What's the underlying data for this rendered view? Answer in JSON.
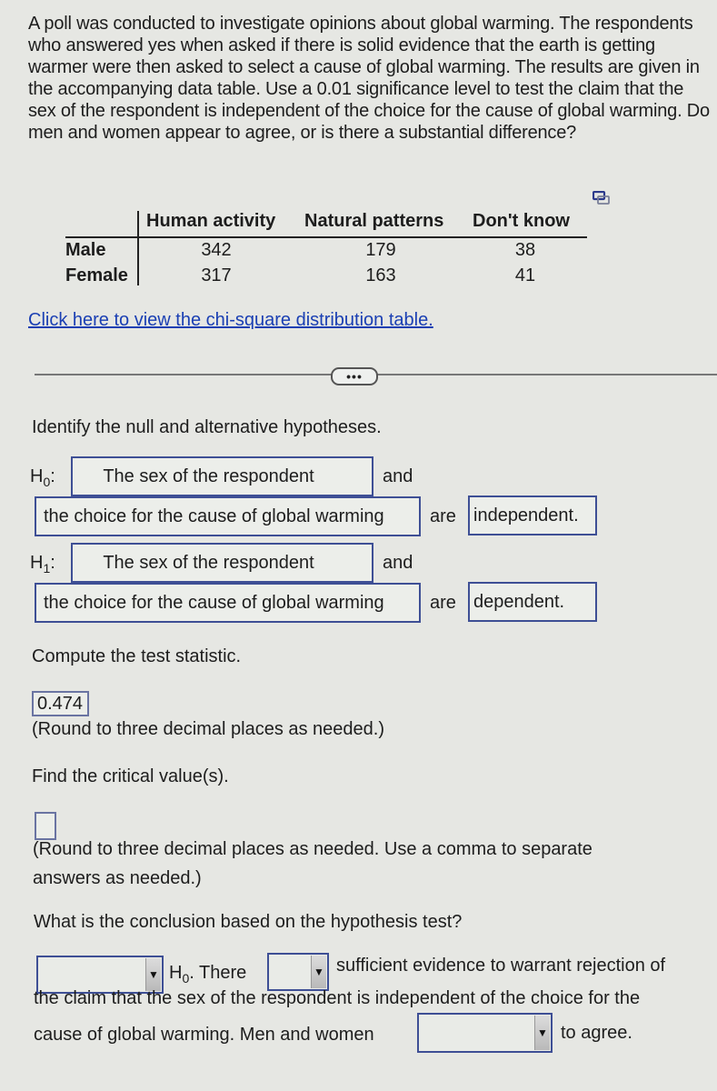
{
  "problem": {
    "intro": "A poll was conducted to investigate opinions about global warming. The respondents who answered yes when asked if there is solid evidence that the earth is getting warmer were then asked to select a cause of global warming. The results are given in the accompanying data table. Use a 0.01 significance level to test the claim that the sex of the respondent is independent of the choice for the cause of global warming. Do men and women appear to agree, or is there a substantial difference?"
  },
  "table": {
    "columns": [
      "Human activity",
      "Natural patterns",
      "Don't know"
    ],
    "rows": [
      {
        "label": "Male",
        "values": [
          "342",
          "179",
          "38"
        ]
      },
      {
        "label": "Female",
        "values": [
          "317",
          "163",
          "41"
        ]
      }
    ],
    "copy_icon": "copy-icon"
  },
  "link_text": "Click here to view the chi-square distribution table.",
  "more_button": "•••",
  "hypotheses": {
    "prompt": "Identify the null and alternative hypotheses.",
    "h0": {
      "label": "H",
      "sub": "0",
      "colon": ":",
      "first": "The sex of the respondent",
      "and": "and",
      "second": "the choice for the cause of global warming",
      "are": "are",
      "relation": "independent."
    },
    "h1": {
      "label": "H",
      "sub": "1",
      "colon": ":",
      "first": "The sex of the respondent",
      "and": "and",
      "second": "the choice for the cause of global warming",
      "are": "are",
      "relation": "dependent."
    }
  },
  "test_statistic": {
    "prompt": "Compute the test statistic.",
    "value": "0.474",
    "note": "(Round to three decimal places as needed.)"
  },
  "critical": {
    "prompt": "Find the critical value(s).",
    "value": "",
    "note_line1": "(Round to three decimal places as needed. Use a comma to separate",
    "note_line2": "answers as needed.)"
  },
  "conclusion": {
    "prompt": "What is the conclusion based on the hypothesis test?",
    "dropdown1_value": "",
    "h0_label": "H",
    "h0_sub": "0",
    "there": ". There",
    "dropdown2_value": "",
    "text1": "sufficient evidence to warrant rejection of",
    "text2": "the claim that the sex of the respondent is independent of the choice for the",
    "text3": "cause of global warming. Men and women",
    "dropdown3_value": "",
    "text4": "to agree.",
    "arrow_glyph": "▼"
  }
}
